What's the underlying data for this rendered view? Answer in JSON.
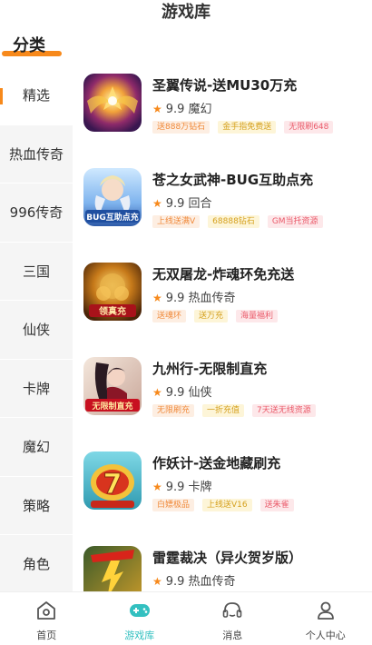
{
  "header": {
    "title": "游戏库"
  },
  "category_header": {
    "label": "分类"
  },
  "sidebar": {
    "items": [
      {
        "label": "精选",
        "active": true
      },
      {
        "label": "热血传奇"
      },
      {
        "label": "996传奇"
      },
      {
        "label": "三国"
      },
      {
        "label": "仙侠"
      },
      {
        "label": "卡牌"
      },
      {
        "label": "魔幻"
      },
      {
        "label": "策略"
      },
      {
        "label": "角色"
      }
    ]
  },
  "games": [
    {
      "name": "圣翼传说-送MU30万充",
      "rating": "9.9",
      "genre": "魔幻",
      "tags": [
        "送888万钻石",
        "金手指免费送",
        "无限刷648"
      ],
      "icon": "wing-game-icon"
    },
    {
      "name": "苍之女武神-BUG互助点充",
      "rating": "9.9",
      "genre": "回合",
      "tags": [
        "上线送满V",
        "68888钻石",
        "GM当托资源"
      ],
      "icon": "valkyrie-game-icon",
      "icon_text": "BUG互助点充"
    },
    {
      "name": "无双屠龙-炸魂环免充送",
      "rating": "9.9",
      "genre": "热血传奇",
      "tags": [
        "送魂环",
        "送万充",
        "海量福利"
      ],
      "icon": "dragon-game-icon",
      "icon_text": "领真充"
    },
    {
      "name": "九州行-无限制直充",
      "rating": "9.9",
      "genre": "仙侠",
      "tags": [
        "无限刷充",
        "一折充值",
        "7天送无线资源"
      ],
      "icon": "jiuzhou-game-icon",
      "icon_text": "无限制直充"
    },
    {
      "name": "作妖计-送金地藏刷充",
      "rating": "9.9",
      "genre": "卡牌",
      "tags": [
        "白嫖极品",
        "上线送V16",
        "送朱雀"
      ],
      "icon": "zuoyaoji-game-icon",
      "icon_text": "7"
    },
    {
      "name": "雷霆裁决（异火贺岁版）",
      "rating": "9.9",
      "genre": "热血传奇",
      "tags": [],
      "icon": "thunder-game-icon"
    }
  ],
  "bottom_nav": [
    {
      "label": "首页",
      "icon": "home-icon"
    },
    {
      "label": "游戏库",
      "icon": "gamepad-icon",
      "active": true
    },
    {
      "label": "消息",
      "icon": "headset-icon"
    },
    {
      "label": "个人中心",
      "icon": "person-icon"
    }
  ],
  "colors": {
    "accent": "#f7891b",
    "teal": "#33c0c0"
  }
}
